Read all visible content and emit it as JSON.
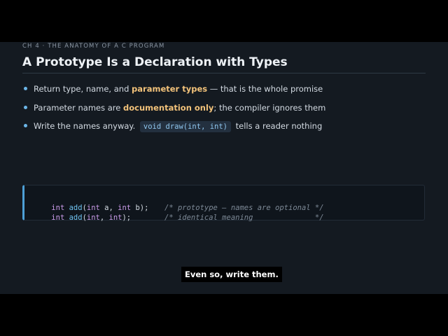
{
  "slide": {
    "chapter": "CH 4 · THE ANATOMY OF A C PROGRAM",
    "title": "A Prototype Is a Declaration with Types",
    "bullets": [
      {
        "pre": "Return type, name, and ",
        "highlight": "parameter types",
        "post": " — that is the whole promise"
      },
      {
        "pre": "Parameter names are ",
        "highlight": "documentation only",
        "post": "; the compiler ignores them"
      },
      {
        "pre": "Write the names anyway.",
        "code": "void draw(int, int)",
        "post": "tells a reader nothing"
      }
    ],
    "code": {
      "line1": {
        "kw1": "int",
        "fn": "add",
        "p1": "(",
        "kw2": "int",
        "a1": " a, ",
        "kw3": "int",
        "a2": " b);",
        "comment": "/* prototype — names are optional */"
      },
      "line2": {
        "kw1": "int",
        "fn": "add",
        "p1": "(",
        "kw2": "int",
        "a1": ", ",
        "kw3": "int",
        "a2": ");",
        "comment": "/* identical meaning              */"
      }
    }
  },
  "caption": "Even so, write them.",
  "colors": {
    "slide_bg": "#141a21",
    "highlight": "#f2c27a",
    "bullet_dot": "#6cb6e8",
    "code_accent": "#4d9fd6"
  }
}
